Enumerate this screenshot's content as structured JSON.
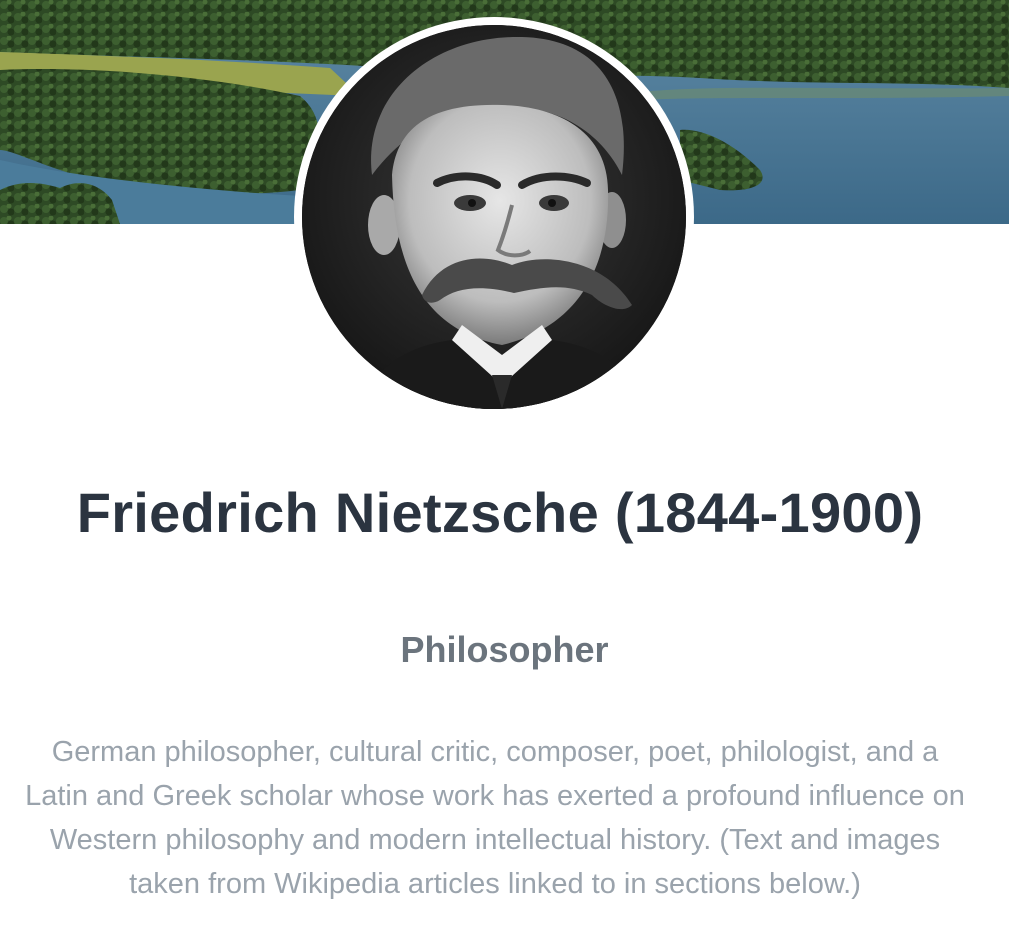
{
  "banner": {
    "image": "landscape-lake-forest"
  },
  "profile": {
    "avatar": "portrait-photo",
    "name": "Friedrich Nietzsche (1844-1900)",
    "role": "Philosopher",
    "bio": "German philosopher, cultural critic, composer, poet, philologist, and a Latin and Greek scholar whose work has exerted a profound influence on Western philosophy and modern intellectual history. (Text and images taken from Wikipedia articles linked to in sections below.)"
  },
  "colors": {
    "name_text": "#2b3440",
    "role_text": "#6b747d",
    "bio_text": "#9aa3ac",
    "lake": "#3f6f8f",
    "forest": "#2f4a26"
  }
}
